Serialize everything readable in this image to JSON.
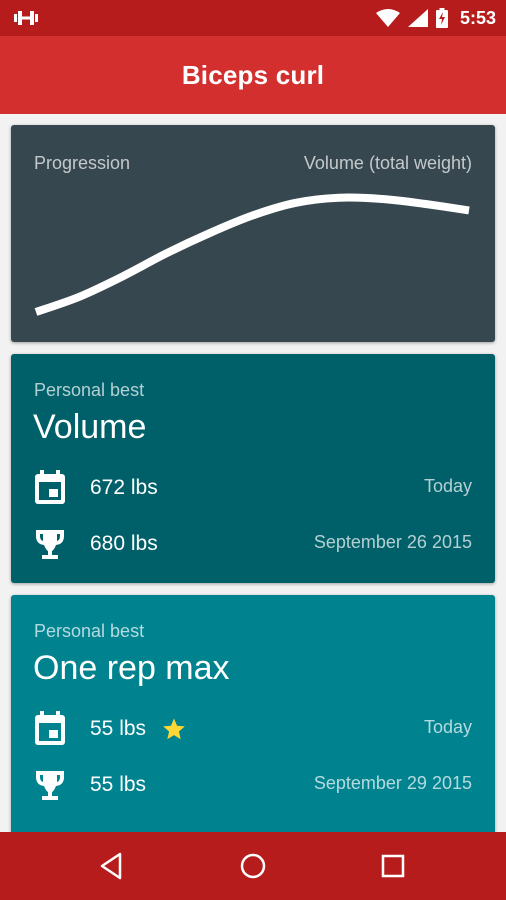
{
  "status_bar": {
    "time": "5:53",
    "icons": [
      "dumbbell-icon",
      "wifi-icon",
      "signal-icon",
      "battery-charging-icon"
    ]
  },
  "app_bar": {
    "title": "Biceps curl"
  },
  "chart_card": {
    "left_label": "Progression",
    "right_label": "Volume (total weight)"
  },
  "chart_data": {
    "type": "line",
    "title": "",
    "xlabel": "Progression",
    "ylabel": "Volume (total weight)",
    "x": [
      0,
      1,
      2,
      3,
      4,
      5,
      6,
      7,
      8,
      9,
      10
    ],
    "series": [
      {
        "values": [
          0.0,
          0.12,
          0.28,
          0.46,
          0.62,
          0.76,
          0.86,
          0.9,
          0.89,
          0.85,
          0.8
        ]
      }
    ],
    "ylim": [
      0,
      1
    ],
    "grid": false,
    "color": "#ffffff"
  },
  "volume_card": {
    "kicker": "Personal best",
    "heading": "Volume",
    "rows": [
      {
        "icon": "calendar-icon",
        "value": "672 lbs",
        "date": "Today"
      },
      {
        "icon": "trophy-icon",
        "value": "680 lbs",
        "date": "September 26 2015"
      }
    ]
  },
  "orm_card": {
    "kicker": "Personal best",
    "heading": "One rep max",
    "rows": [
      {
        "icon": "calendar-icon",
        "value": "55 lbs",
        "date": "Today",
        "badge": "star-icon"
      },
      {
        "icon": "trophy-icon",
        "value": "55 lbs",
        "date": "September 29 2015"
      }
    ]
  },
  "nav_bar": {
    "buttons": [
      "back-icon",
      "home-icon",
      "recents-icon"
    ]
  },
  "colors": {
    "status_bar": "#b71c1c",
    "app_bar": "#d32f2f",
    "chart_card": "#37474f",
    "volume_card": "#00606a",
    "orm_card": "#00838f",
    "star": "#fdd835"
  }
}
